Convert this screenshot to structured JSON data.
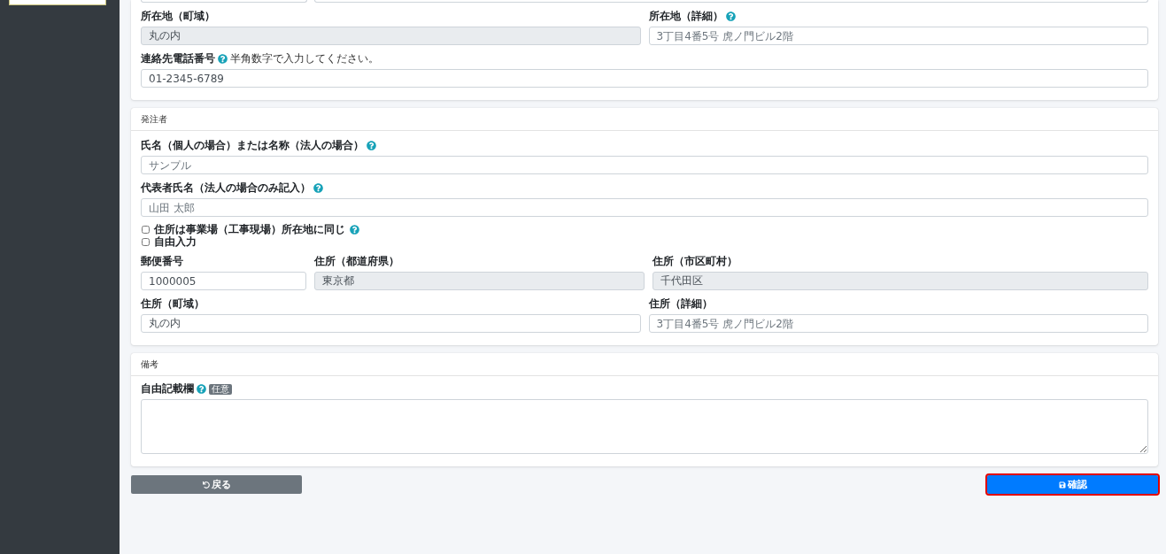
{
  "sidebar": {
    "button": {
      "kind": "cut"
    }
  },
  "top_card": {
    "rows": [
      [
        {
          "label": "所在地（町域）",
          "help": false,
          "value": "丸の内",
          "readonly": true
        },
        {
          "label": "所在地（詳細）",
          "help": true,
          "placeholder": "3丁目4番5号 虎ノ門ビル2階",
          "readonly": false
        }
      ],
      [
        {
          "label": "連絡先電話番号",
          "help": true,
          "hint": "半角数字で入力してください。",
          "value": "01-2345-6789",
          "readonly": false
        }
      ]
    ]
  },
  "orderer": {
    "title": "発注者",
    "rows": [
      [
        {
          "label": "氏名（個人の場合）または名称（法人の場合）",
          "help": true,
          "placeholder": "サンプル",
          "readonly": false
        }
      ],
      [
        {
          "label": "代表者氏名（法人の場合のみ記入）",
          "help": true,
          "placeholder": "山田 太郎",
          "readonly": false
        }
      ]
    ],
    "checkboxes": [
      {
        "label": "住所は事業場（工事現場）所在地に同じ",
        "help": true,
        "checked": false
      },
      {
        "label": "自由入力",
        "help": false,
        "checked": false
      }
    ],
    "address_rows": [
      [
        {
          "kind": "postal",
          "label": "郵便番号",
          "help": false,
          "value": "1000005",
          "readonly": false
        },
        {
          "label": "住所（都道府県）",
          "help": false,
          "value": "東京都",
          "readonly": true
        },
        {
          "label": "住所（市区町村）",
          "help": false,
          "value": "千代田区",
          "readonly": true
        }
      ],
      [
        {
          "label": "住所（町域）",
          "help": false,
          "value": "丸の内",
          "readonly": false
        },
        {
          "label": "住所（詳細）",
          "help": false,
          "placeholder": "3丁目4番5号 虎ノ門ビル2階",
          "readonly": false
        }
      ]
    ]
  },
  "remarks": {
    "title": "備考",
    "label": "自由記載欄",
    "help": true,
    "badge": "任意"
  },
  "buttons": {
    "back": "戻る",
    "confirm": "確認",
    "confirm_focused": true
  }
}
